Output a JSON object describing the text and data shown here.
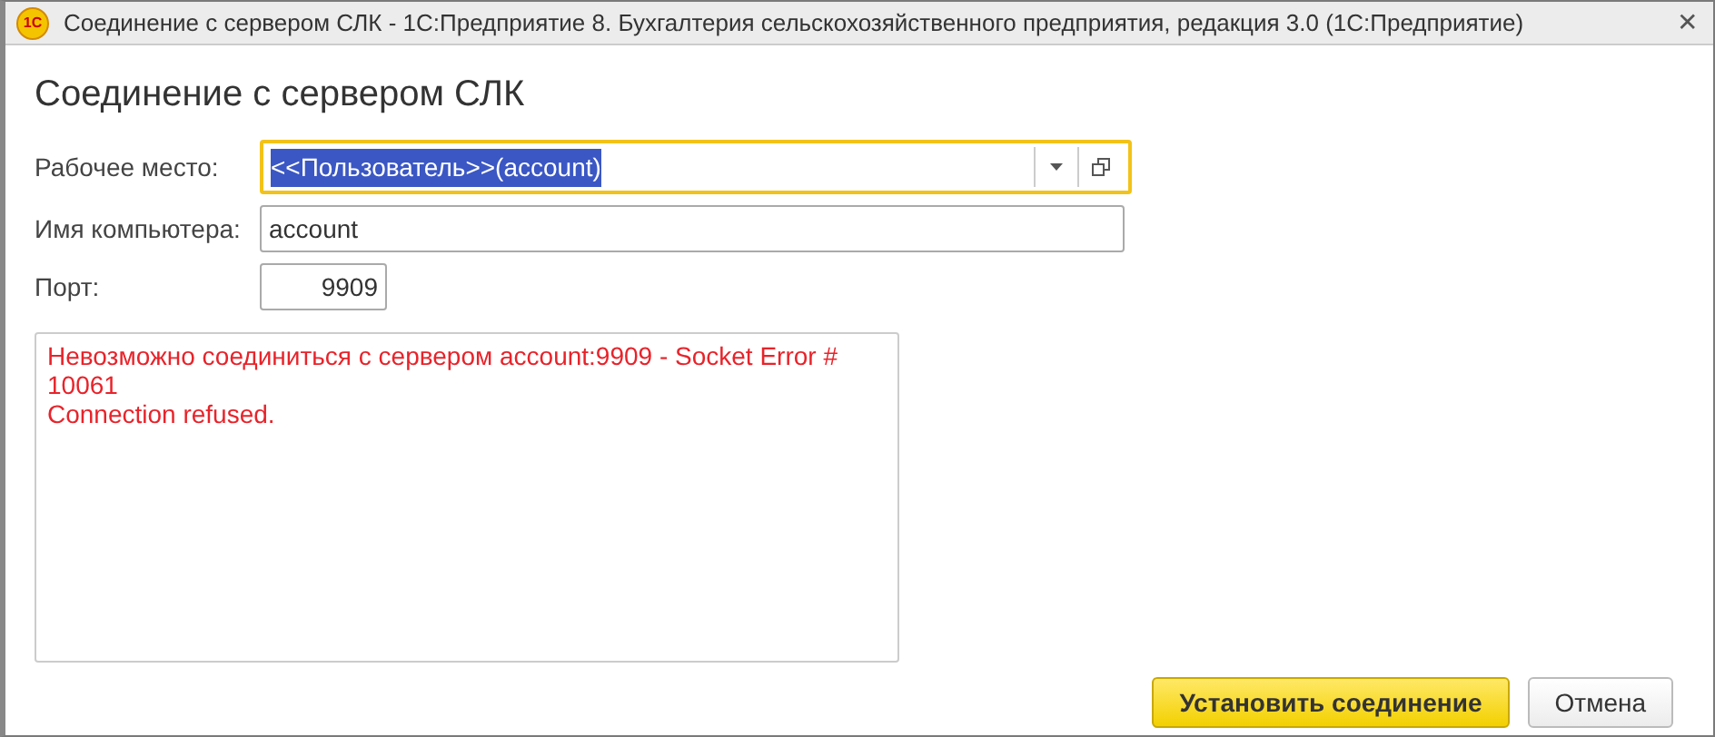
{
  "window": {
    "title": "Соединение с сервером СЛК - 1С:Предприятие 8. Бухгалтерия сельскохозяйственного предприятия, редакция 3.0  (1С:Предприятие)",
    "logo": "1С",
    "close": "✕"
  },
  "form_title": "Соединение с сервером СЛК",
  "fields": [
    {
      "kind": "combo",
      "label": "Рабочее место:",
      "value": "<<Пользователь>>(account)",
      "focused": true,
      "text_selected": true
    },
    {
      "kind": "text",
      "label": "Имя компьютера:",
      "value": "account",
      "focused": false,
      "text_selected": false
    },
    {
      "kind": "number",
      "label": "Порт:",
      "value": "9909",
      "focused": false,
      "text_selected": false
    }
  ],
  "message_lines": [
    "Невозможно соединиться с сервером account:9909 - Socket Error #",
    "10061",
    "Connection refused."
  ],
  "buttons": [
    {
      "label": "Установить соединение",
      "default": true
    },
    {
      "label": "Отмена",
      "default": false
    }
  ]
}
